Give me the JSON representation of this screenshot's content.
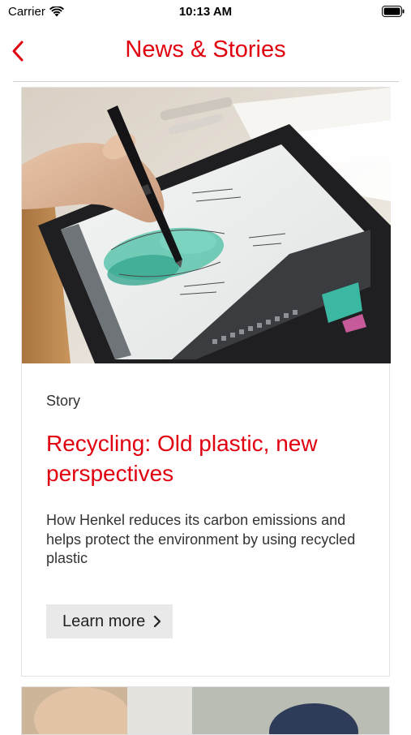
{
  "status": {
    "carrier": "Carrier",
    "time": "10:13 AM",
    "icons": [
      "wifi-icon",
      "battery-icon"
    ]
  },
  "nav": {
    "title": "News & Stories",
    "back_icon": "chevron-left-icon"
  },
  "colors": {
    "accent": "#e1000f",
    "button_bg": "#e9e9e9",
    "divider": "#cfcfcf"
  },
  "article": {
    "category": "Story",
    "title": "Recycling: Old plastic, new perspectives",
    "summary": "How Henkel reduces its carbon emissions and helps protect the environment by using recycled plastic",
    "cta_label": "Learn more",
    "cta_icon": "chevron-right-icon"
  }
}
